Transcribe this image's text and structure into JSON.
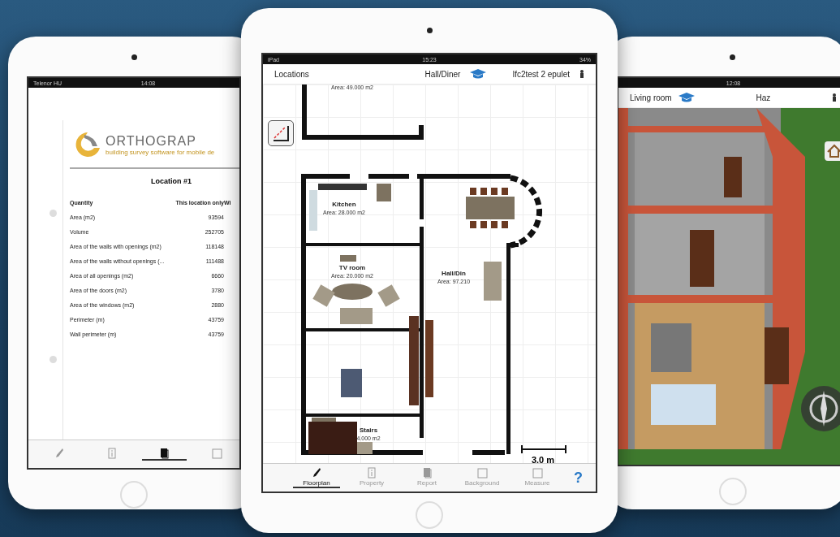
{
  "report_tablet": {
    "status": {
      "carrier": "Telenor HU",
      "time": "14:08"
    },
    "report": {
      "brand": "ORTHOGRAP",
      "tagline": "building survey software for mobile de",
      "heading": "Location #1",
      "columns": [
        "Quantity",
        "This location only",
        "Wi"
      ],
      "rows": [
        {
          "quantity": "Area (m2)",
          "value": "93594"
        },
        {
          "quantity": "Volume",
          "value": "252705"
        },
        {
          "quantity": "Area of the walls with openings (m2)",
          "value": "118148"
        },
        {
          "quantity": "Area of the walls without openings (...",
          "value": "111488"
        },
        {
          "quantity": "Area of all openings (m2)",
          "value": "6660"
        },
        {
          "quantity": "Area of the doors (m2)",
          "value": "3780"
        },
        {
          "quantity": "Area of the windows (m2)",
          "value": "2880"
        },
        {
          "quantity": "Perimeter (m)",
          "value": "43759"
        },
        {
          "quantity": "Wall perimeter (m)",
          "value": "43759"
        }
      ]
    },
    "tabs": [
      {
        "kind": "pen",
        "selected": false
      },
      {
        "kind": "info",
        "selected": false
      },
      {
        "kind": "report",
        "selected": true
      },
      {
        "kind": "background",
        "selected": false
      }
    ]
  },
  "floorplan_tablet": {
    "status": {
      "device": "iPad",
      "time": "15:23",
      "battery": "34%"
    },
    "nav": {
      "back": "Locations",
      "location": "Hall/Diner",
      "project": "Ifc2test 2 epulet"
    },
    "plan": {
      "top_area": "Area: 49.000 m2",
      "rooms": [
        {
          "name": "Kitchen",
          "area": "Area: 28.000 m2"
        },
        {
          "name": "TV room",
          "area": "Area: 20.000 m2"
        },
        {
          "name": "Hall/Din",
          "area": "Area: 97.210"
        },
        {
          "name": "Stairs",
          "area": "4.000 m2"
        }
      ],
      "scale": "3.0 m"
    },
    "tabs": [
      {
        "kind": "pen",
        "label": "Floorplan",
        "selected": true
      },
      {
        "kind": "info",
        "label": "Property",
        "selected": false
      },
      {
        "kind": "report",
        "label": "Report",
        "selected": false
      },
      {
        "kind": "background",
        "label": "Background",
        "selected": false
      },
      {
        "kind": "background",
        "label": "Measure",
        "selected": false
      }
    ],
    "help": "?"
  },
  "view3d_tablet": {
    "status": {
      "time": "12:08"
    },
    "nav": {
      "location": "Living room",
      "project": "Haz"
    }
  }
}
